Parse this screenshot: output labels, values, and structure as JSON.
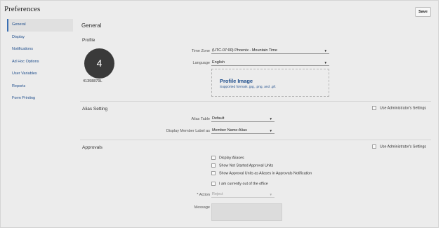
{
  "page": {
    "title": "Preferences",
    "save_label": "Save"
  },
  "sidebar": {
    "items": [
      {
        "label": "General"
      },
      {
        "label": "Display"
      },
      {
        "label": "Notifications"
      },
      {
        "label": "Ad Hoc Options"
      },
      {
        "label": "User Variables"
      },
      {
        "label": "Reports"
      },
      {
        "label": "Form Printing"
      }
    ]
  },
  "general": {
    "title": "General"
  },
  "profile": {
    "title": "Profile",
    "avatar_text": "4",
    "user_id": "41398879L",
    "timezone_label": "Time Zone",
    "timezone_value": "(UTC-07:00) Phoenix - Mountain Time",
    "language_label": "Language",
    "language_value": "English",
    "image_title": "Profile Image",
    "image_formats": "Supported formats .jpg, .png, and .gif."
  },
  "alias": {
    "title": "Alias Setting",
    "admin_label": "Use Administrator's Settings",
    "table_label": "Alias Table",
    "table_value": "Default",
    "display_label": "Display Member Label as",
    "display_value": "Member Name:Alias"
  },
  "approvals": {
    "title": "Approvals",
    "admin_label": "Use Administrator's Settings",
    "display_aliases": "Display Aliases",
    "show_not_started": "Show Not Started Approval Units",
    "show_as_aliases": "Show Approval Units as Aliases in Approvals Notification",
    "out_of_office": "I am currently out of the office",
    "action_required": "*",
    "action_label": "Action",
    "action_value": "Reject",
    "message_label": "Message"
  }
}
